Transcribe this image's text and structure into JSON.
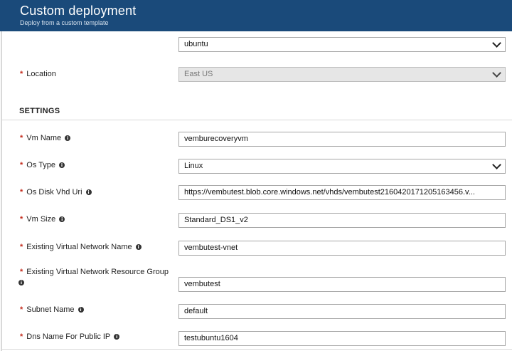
{
  "header": {
    "title": "Custom deployment",
    "subtitle": "Deploy from a custom template"
  },
  "top_fields": {
    "image_value": "ubuntu",
    "location_label": "Location",
    "location_value": "East US"
  },
  "settings": {
    "section_title": "SETTINGS",
    "vm_name_label": "Vm Name",
    "vm_name_value": "vemburecoveryvm",
    "os_type_label": "Os Type",
    "os_type_value": "Linux",
    "os_disk_label": "Os Disk Vhd Uri",
    "os_disk_value": "https://vembutest.blob.core.windows.net/vhds/vembutest2160420171205163456.v...",
    "vm_size_label": "Vm Size",
    "vm_size_value": "Standard_DS1_v2",
    "vnet_name_label": "Existing Virtual Network Name",
    "vnet_name_value": "vembutest-vnet",
    "vnet_rg_label": "Existing Virtual Network Resource Group",
    "vnet_rg_value": "vembutest",
    "subnet_label": "Subnet Name",
    "subnet_value": "default",
    "dns_label": "Dns Name For Public IP",
    "dns_value": "testubuntu1604"
  },
  "required_mark": "*",
  "info_glyph": "i",
  "colors": {
    "header_bg": "#1a4a7a",
    "required": "#c42b1c"
  }
}
